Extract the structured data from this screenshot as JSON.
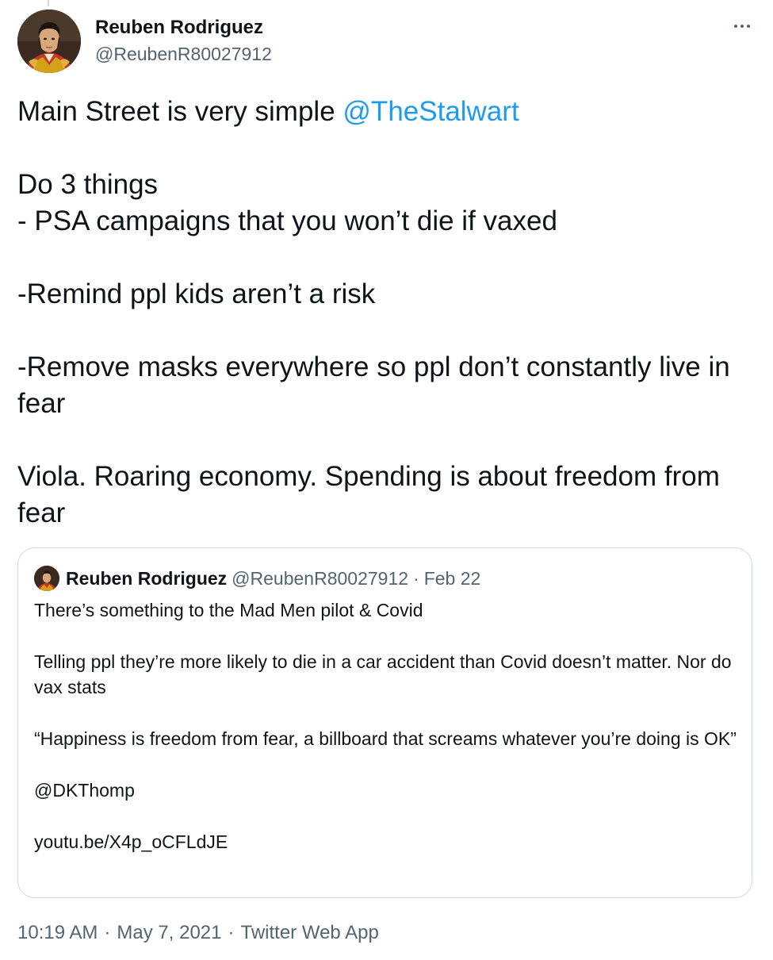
{
  "tweet": {
    "author_name": "Reuben Rodriguez",
    "author_handle": "@ReubenR80027912",
    "more_icon": "more-dots-icon",
    "body": {
      "line1_text": "Main Street is very simple ",
      "line1_mention": "@TheStalwart",
      "line2": "Do 3 things",
      "line3": "- PSA campaigns that you won’t die if vaxed",
      "line4": "-Remind ppl kids aren’t a risk",
      "line5": "-Remove masks everywhere so ppl don’t constantly live in fear",
      "line6": "Viola. Roaring economy. Spending is about freedom from fear"
    },
    "time": "10:19 AM",
    "date": "May 7, 2021",
    "source": "Twitter Web App",
    "separator": "·"
  },
  "quoted_tweet": {
    "author_name": "Reuben Rodriguez",
    "author_handle": "@ReubenR80027912",
    "date": "Feb 22",
    "separator": "·",
    "lines": [
      "There’s something to the Mad Men pilot & Covid",
      "Telling ppl they’re more likely to die in a car accident than Covid doesn’t matter. Nor do vax stats",
      "“Happiness is freedom from fear, a billboard that screams whatever you’re doing is OK”",
      "@DKThomp",
      "youtu.be/X4p_oCFLdJE"
    ]
  },
  "colors": {
    "link": "#1d9bf0",
    "secondary_text": "#536471",
    "primary_text": "#0f1419",
    "border": "#cfd9de"
  }
}
